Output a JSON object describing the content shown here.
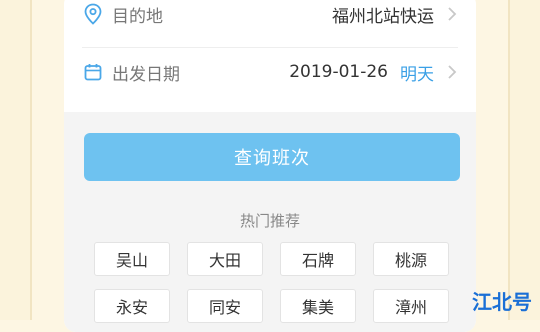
{
  "destination": {
    "label": "目的地",
    "value": "福州北站快运",
    "icon": "location-pin-icon"
  },
  "departure": {
    "label": "出发日期",
    "value": "2019-01-26",
    "relative": "明天",
    "icon": "calendar-icon"
  },
  "query_button": {
    "label": "查询班次"
  },
  "hot": {
    "title": "热门推荐",
    "items": [
      "吴山",
      "大田",
      "石牌",
      "桃源",
      "永安",
      "同安",
      "集美",
      "漳州"
    ]
  },
  "watermark": "江北号",
  "colors": {
    "accent": "#3aa0e6",
    "button": "#6ec2f0",
    "watermark": "#1a6fd6"
  }
}
